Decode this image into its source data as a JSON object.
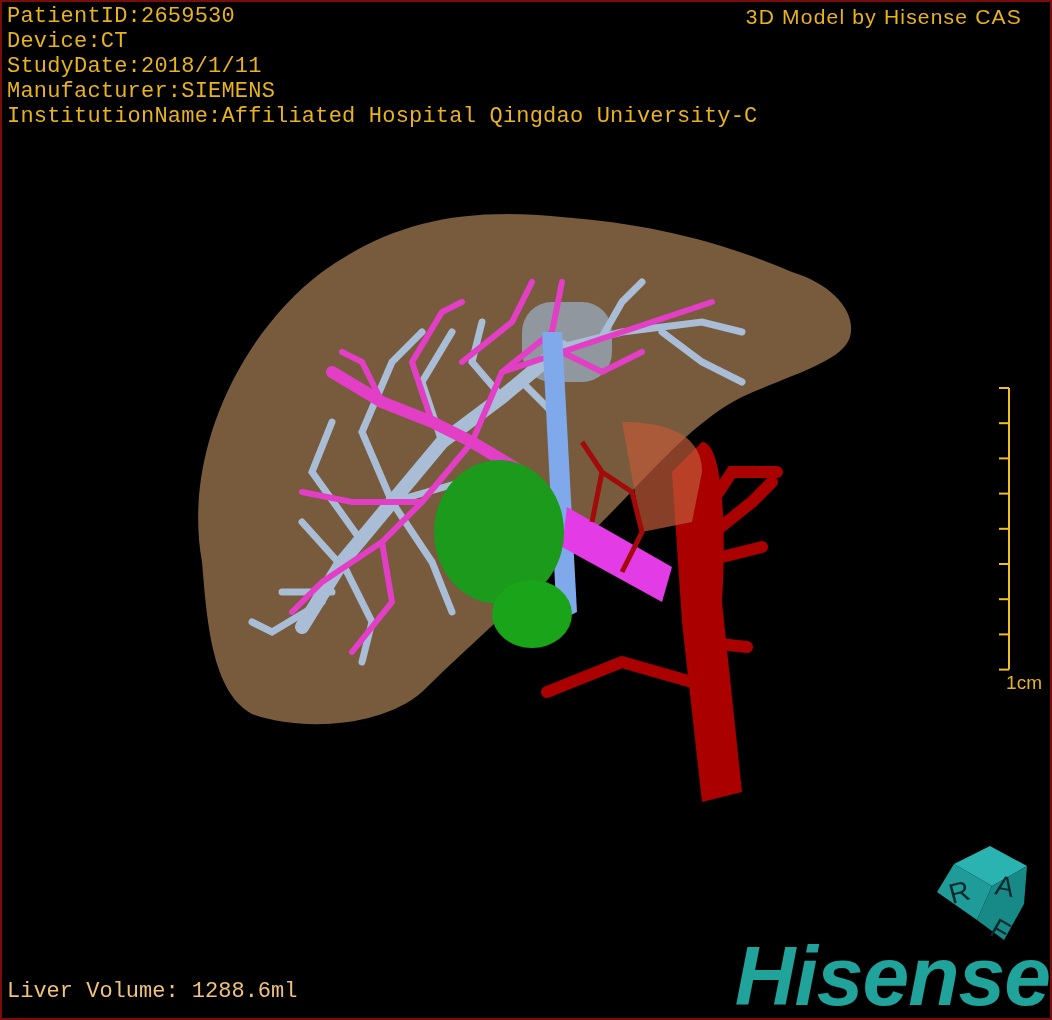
{
  "overlay": {
    "info_lines": [
      "PatientID:2659530",
      "Device:CT",
      "StudyDate:2018/1/11",
      "Manufacturer:SIEMENS",
      "InstitutionName:Affiliated Hospital Qingdao University-C"
    ],
    "credit": "3D Model by Hisense CAS"
  },
  "scale_bar": {
    "label": "1cm"
  },
  "orientation_cube": {
    "letters": [
      "R",
      "A",
      "F"
    ]
  },
  "logo": "Hisense",
  "footer": {
    "liver_volume": "Liver Volume: 1288.6ml"
  }
}
